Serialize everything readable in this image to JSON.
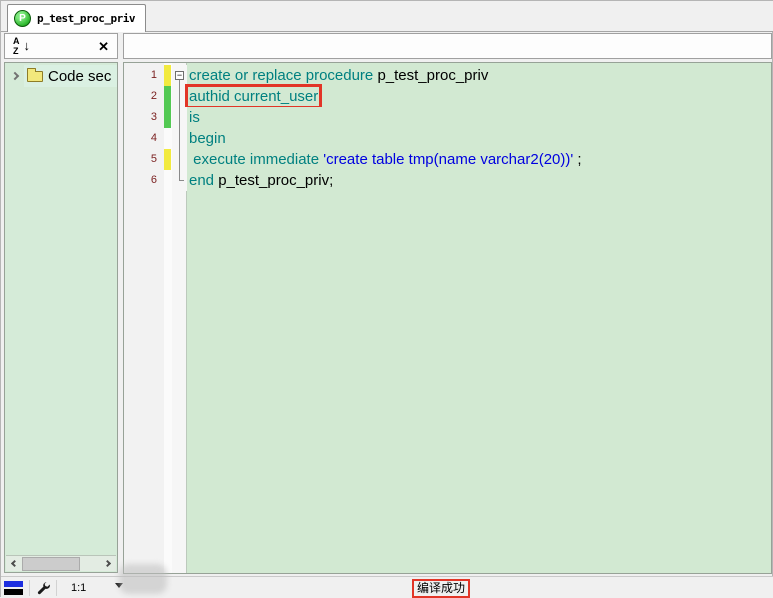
{
  "tab": {
    "title": "p_test_proc_priv",
    "icon": "procedure-icon",
    "icon_letter": "P"
  },
  "toolbar": {
    "sort_a": "A",
    "sort_z": "Z",
    "sort_arrow": "↓",
    "close_label": "✕"
  },
  "browser": {
    "items": [
      {
        "label": "Code sec",
        "icon": "folder-icon"
      }
    ]
  },
  "editor": {
    "background": "#d2e9d2",
    "colors": {
      "keyword": "#008080",
      "string": "#0000e0",
      "plain": "#000000",
      "line_number": "#7a1f1f",
      "change_yellow": "#f2ea3f",
      "change_green": "#53c953",
      "annotation_box": "#e23527"
    },
    "lines": [
      {
        "number": "1",
        "change": "yellow",
        "fold": "minus",
        "boxed": false,
        "segments": [
          {
            "text": "create or replace procedure ",
            "type": "keyword"
          },
          {
            "text": "p_test_proc_priv",
            "type": "plain"
          }
        ]
      },
      {
        "number": "2",
        "change": "green",
        "fold": "line",
        "boxed": true,
        "segments": [
          {
            "text": "authid current_user",
            "type": "keyword"
          }
        ]
      },
      {
        "number": "3",
        "change": "green",
        "fold": "line",
        "boxed": false,
        "segments": [
          {
            "text": "is",
            "type": "keyword"
          }
        ]
      },
      {
        "number": "4",
        "change": "none",
        "fold": "line",
        "boxed": false,
        "segments": [
          {
            "text": "begin",
            "type": "keyword"
          }
        ]
      },
      {
        "number": "5",
        "change": "yellow",
        "fold": "line",
        "boxed": false,
        "segments": [
          {
            "text": " execute immediate ",
            "type": "keyword"
          },
          {
            "text": "'create table tmp(name varchar2(20))'",
            "type": "string"
          },
          {
            "text": " ;",
            "type": "plain"
          }
        ]
      },
      {
        "number": "6",
        "change": "none",
        "fold": "corner",
        "boxed": false,
        "segments": [
          {
            "text": "end",
            "type": "keyword"
          },
          {
            "text": " p_test_proc_priv;",
            "type": "plain"
          }
        ]
      }
    ]
  },
  "statusbar": {
    "zoom": "1:1",
    "message": "编译成功",
    "icons": [
      "compiler-flag-icon",
      "wrench-icon",
      "dropdown-arrow-icon"
    ]
  }
}
